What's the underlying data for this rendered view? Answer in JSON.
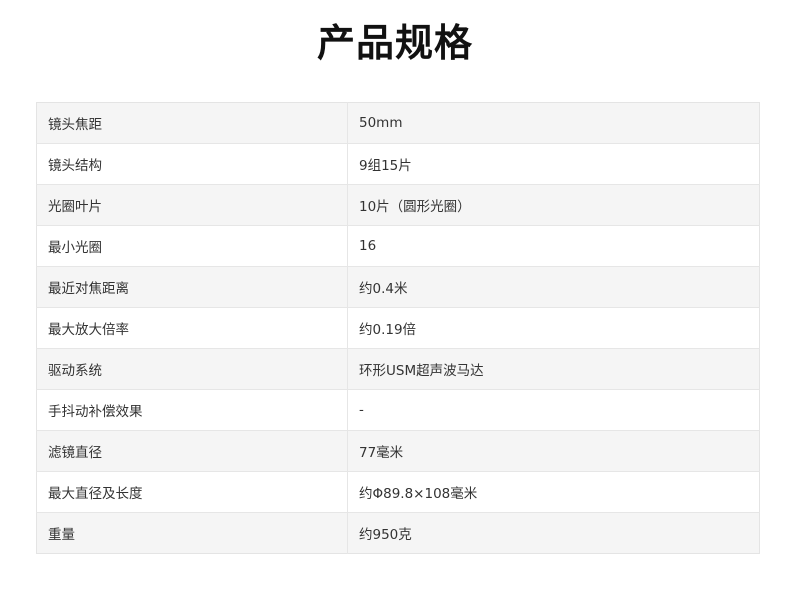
{
  "page": {
    "title": "产品规格"
  },
  "specs": [
    {
      "label": "镜头焦距",
      "value": "50mm"
    },
    {
      "label": "镜头结构",
      "value": "9组15片"
    },
    {
      "label": "光圈叶片",
      "value": "10片（圆形光圈）"
    },
    {
      "label": "最小光圈",
      "value": "16"
    },
    {
      "label": "最近对焦距离",
      "value": "约0.4米"
    },
    {
      "label": "最大放大倍率",
      "value": "约0.19倍"
    },
    {
      "label": "驱动系统",
      "value": "环形USM超声波马达"
    },
    {
      "label": "手抖动补偿效果",
      "value": "-"
    },
    {
      "label": "滤镜直径",
      "value": "77毫米"
    },
    {
      "label": "最大直径及长度",
      "value": "约Φ89.8×108毫米"
    },
    {
      "label": "重量",
      "value": "约950克"
    }
  ]
}
